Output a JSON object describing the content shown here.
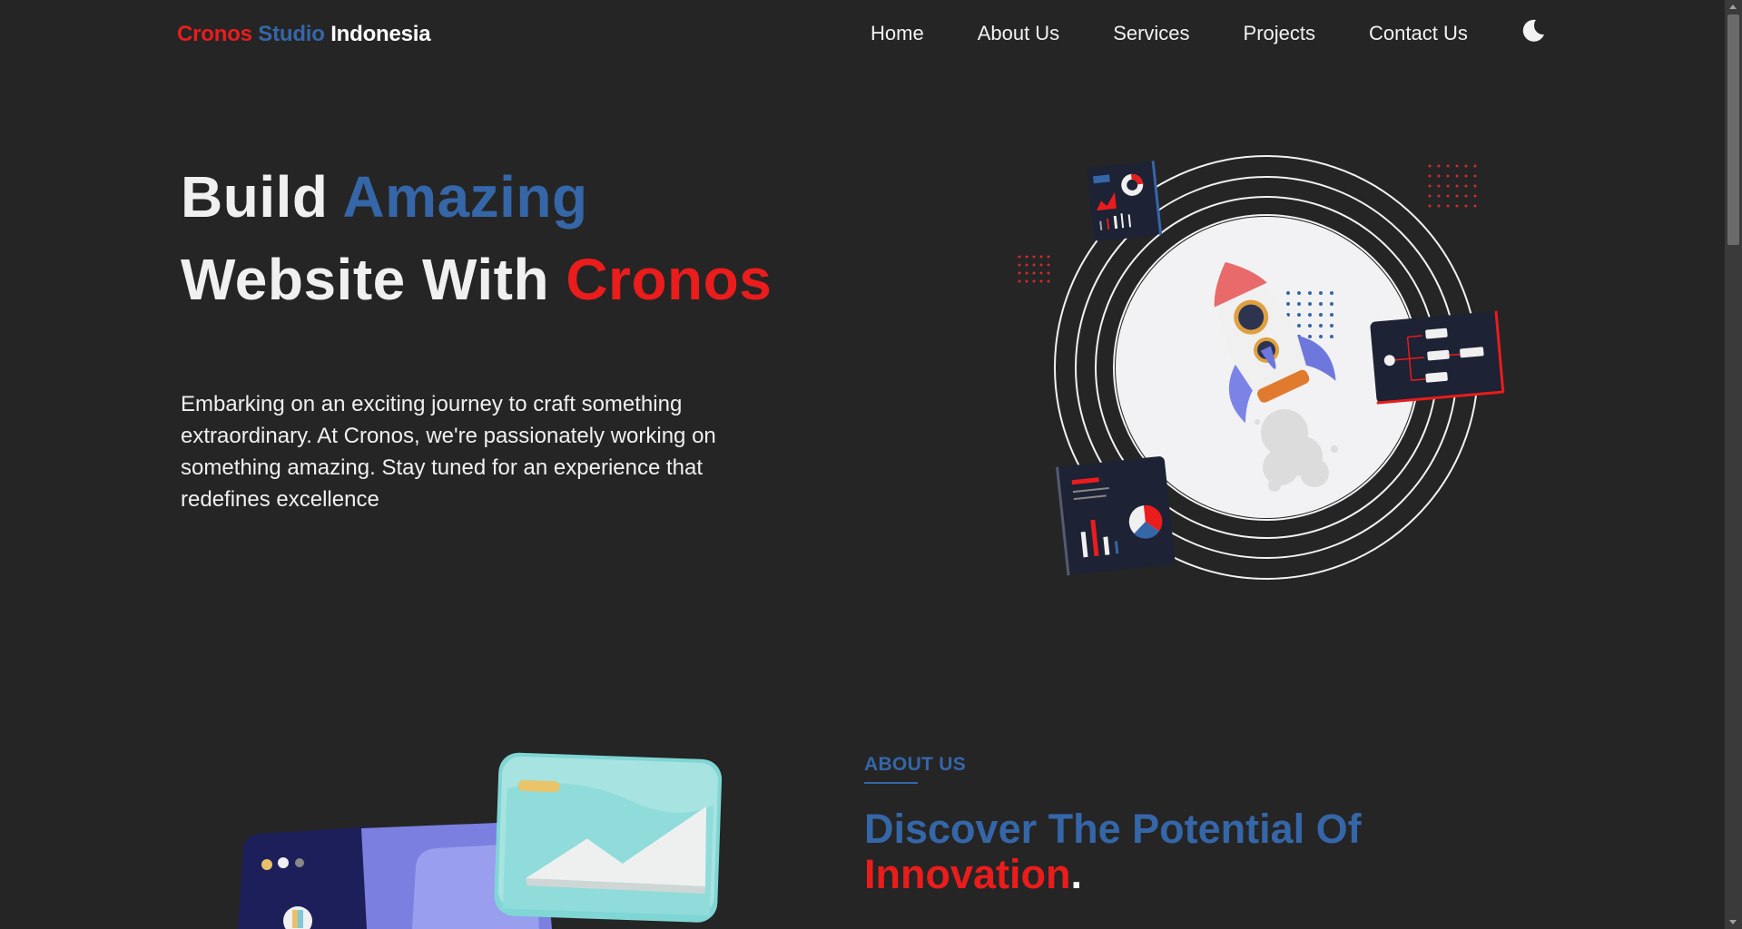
{
  "brand": {
    "part1": "Cronos",
    "part2": "Studio",
    "part3": "Indonesia"
  },
  "nav": {
    "items": [
      "Home",
      "About Us",
      "Services",
      "Projects",
      "Contact Us"
    ],
    "theme_icon": "moon-icon"
  },
  "hero": {
    "line1_a": "Build ",
    "line1_b": "Amazing",
    "line2_a": "Website With ",
    "line2_b": "Cronos",
    "description": "Embarking on an exciting journey to craft something extraordinary. At Cronos, we're passionately working on something amazing. Stay tuned for an experience that redefines excellence",
    "illustration": "rocket-launch-illustration"
  },
  "about": {
    "eyebrow": "ABOUT US",
    "title_a": "Discover The Potential Of",
    "title_b": "Innovation",
    "title_c": ".",
    "illustration": "website-cards-illustration"
  },
  "colors": {
    "background": "#252525",
    "brand_red": "#ea1c1c",
    "brand_blue": "#3566a8",
    "text": "#f0f0f0"
  }
}
